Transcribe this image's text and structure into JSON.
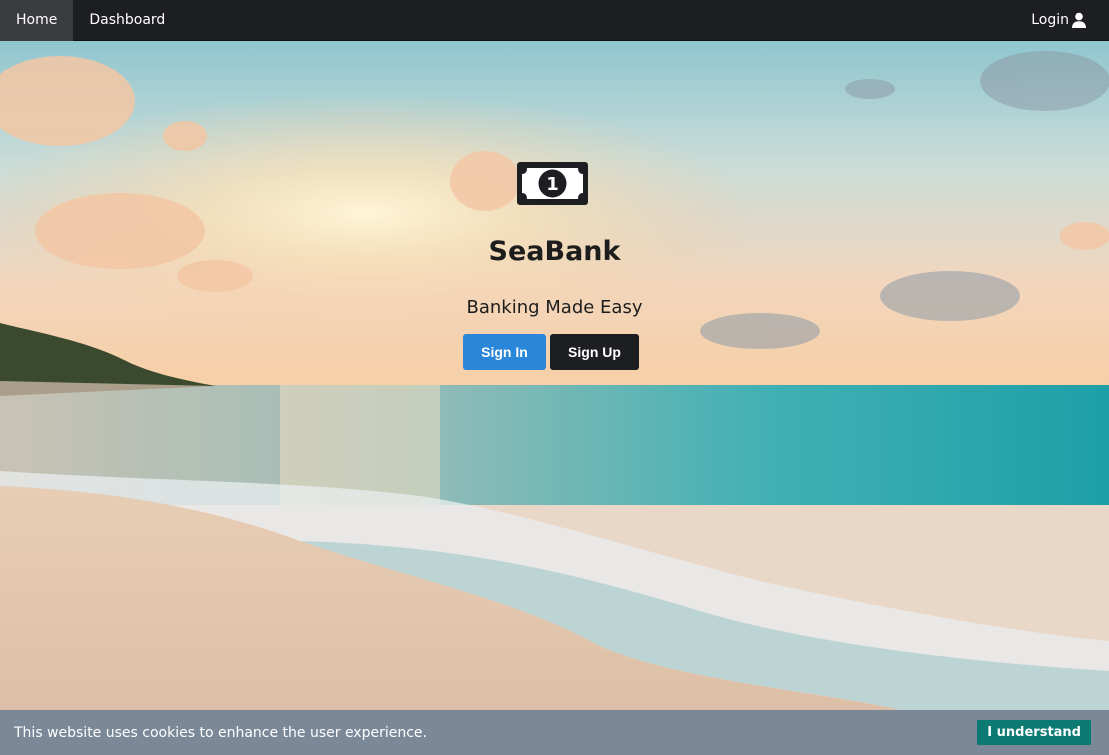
{
  "nav": {
    "items": [
      {
        "label": "Home",
        "active": true
      },
      {
        "label": "Dashboard",
        "active": false
      }
    ],
    "login_label": "Login",
    "login_icon": "user-icon"
  },
  "hero": {
    "logo_icon": "money-bill-icon",
    "title": "SeaBank",
    "tagline": "Banking Made Easy",
    "signin_label": "Sign In",
    "signup_label": "Sign Up"
  },
  "cookie": {
    "message": "This website uses cookies to enhance the user experience.",
    "button_label": "I understand"
  },
  "colors": {
    "navbar": "#1d1e22",
    "signin": "#2a86d8",
    "signup": "#1d1e22",
    "cookie_bar": "#7a8897",
    "cookie_button": "#0b7a73"
  }
}
